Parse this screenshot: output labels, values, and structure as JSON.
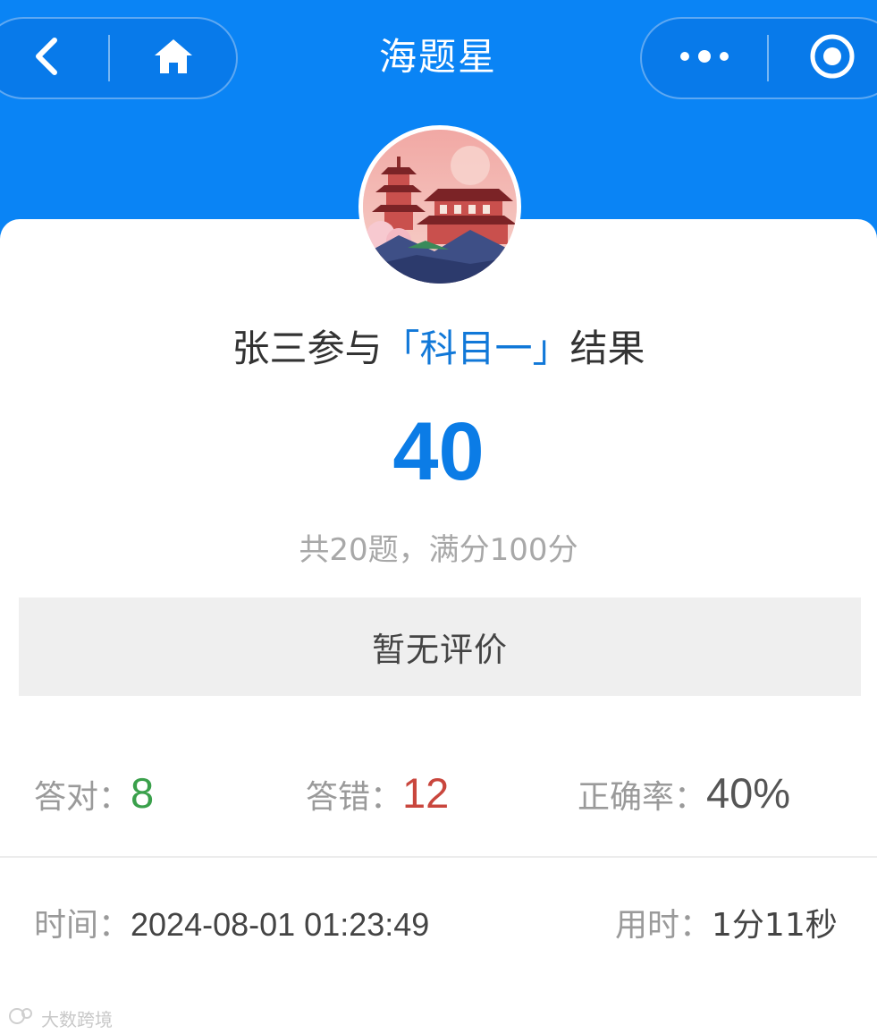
{
  "app": {
    "title": "海题星"
  },
  "nav": {
    "back_icon": "chevron-left-icon",
    "home_icon": "home-icon",
    "more_icon": "more-dots-icon",
    "close_icon": "target-close-icon"
  },
  "colors": {
    "header_bg": "#0a84f5",
    "accent": "#0b7ce6",
    "correct": "#3aa04b",
    "wrong": "#c9463d",
    "neutral_value": "#555555"
  },
  "result": {
    "user_prefix": "张三参与",
    "subject": "「科目一」",
    "suffix": "结果",
    "score": "40",
    "summary": "共20题，满分100分",
    "evaluation": "暂无评价"
  },
  "stats": {
    "correct_label": "答对：",
    "correct_value": "8",
    "wrong_label": "答错：",
    "wrong_value": "12",
    "accuracy_label": "正确率：",
    "accuracy_value": "40%"
  },
  "meta": {
    "time_label": "时间：",
    "time_value": "2024-08-01 01:23:49",
    "duration_label": "用时：",
    "duration_value": "1分11秒"
  },
  "watermark": {
    "text": "大数跨境"
  }
}
